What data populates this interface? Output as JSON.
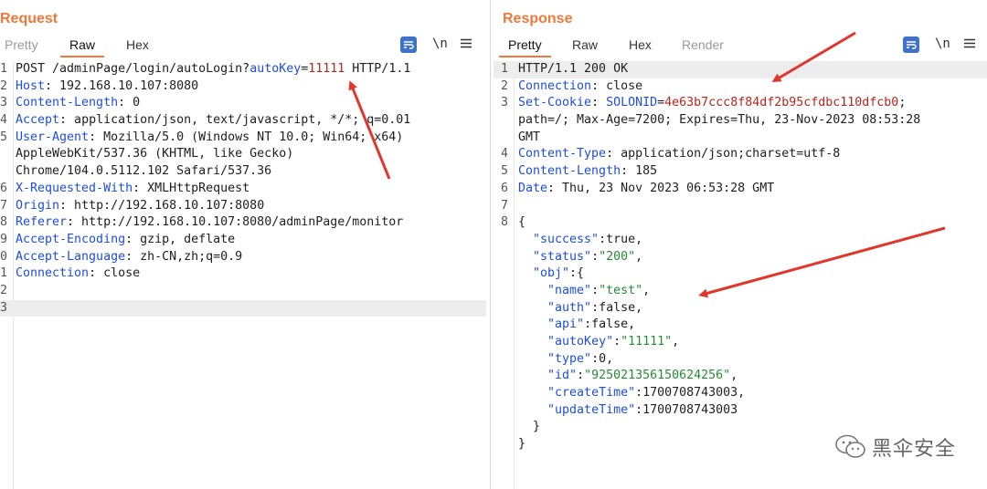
{
  "request": {
    "title": "Request",
    "tabs": [
      "Pretty",
      "Raw",
      "Hex"
    ],
    "active_tab": "Raw",
    "tools": {
      "newline_label": "\\n",
      "menu_icon": "hamburger-menu-icon",
      "wrap_icon": "text-wrap-icon"
    },
    "lines": [
      {
        "n": "1",
        "parts": [
          [
            "t",
            "POST /adminPage/login/autoLogin?"
          ],
          [
            "k",
            "autoKey"
          ],
          [
            "t",
            "="
          ],
          [
            "n",
            "11111"
          ],
          [
            "t",
            " HTTP/1.1"
          ]
        ]
      },
      {
        "n": "2",
        "parts": [
          [
            "k",
            "Host"
          ],
          [
            "t",
            ": 192.168.10.107:8080"
          ]
        ]
      },
      {
        "n": "3",
        "parts": [
          [
            "k",
            "Content-Length"
          ],
          [
            "t",
            ": 0"
          ]
        ]
      },
      {
        "n": "4",
        "parts": [
          [
            "k",
            "Accept"
          ],
          [
            "t",
            ": application/json, text/javascript, */*; q=0.01"
          ]
        ]
      },
      {
        "n": "5",
        "parts": [
          [
            "k",
            "User-Agent"
          ],
          [
            "t",
            ": Mozilla/5.0 (Windows NT 10.0; Win64; x64)"
          ]
        ]
      },
      {
        "n": "",
        "parts": [
          [
            "t",
            "AppleWebKit/537.36 (KHTML, like Gecko)"
          ]
        ]
      },
      {
        "n": "",
        "parts": [
          [
            "t",
            "Chrome/104.0.5112.102 Safari/537.36"
          ]
        ]
      },
      {
        "n": "6",
        "parts": [
          [
            "k",
            "X-Requested-With"
          ],
          [
            "t",
            ": XMLHttpRequest"
          ]
        ]
      },
      {
        "n": "7",
        "parts": [
          [
            "k",
            "Origin"
          ],
          [
            "t",
            ": http://192.168.10.107:8080"
          ]
        ]
      },
      {
        "n": "8",
        "parts": [
          [
            "k",
            "Referer"
          ],
          [
            "t",
            ": http://192.168.10.107:8080/adminPage/monitor"
          ]
        ]
      },
      {
        "n": "9",
        "parts": [
          [
            "k",
            "Accept-Encoding"
          ],
          [
            "t",
            ": gzip, deflate"
          ]
        ]
      },
      {
        "n": "0",
        "parts": [
          [
            "k",
            "Accept-Language"
          ],
          [
            "t",
            ": zh-CN,zh;q=0.9"
          ]
        ]
      },
      {
        "n": "1",
        "parts": [
          [
            "k",
            "Connection"
          ],
          [
            "t",
            ": close"
          ]
        ]
      },
      {
        "n": "2",
        "parts": []
      },
      {
        "n": "3",
        "parts": [],
        "highlight": true
      }
    ]
  },
  "response": {
    "title": "Response",
    "tabs": [
      "Pretty",
      "Raw",
      "Hex",
      "Render"
    ],
    "active_tab": "Pretty",
    "muted_tabs": [
      "Render"
    ],
    "tools": {
      "newline_label": "\\n",
      "menu_icon": "hamburger-menu-icon",
      "wrap_icon": "text-wrap-icon"
    },
    "lines": [
      {
        "n": "1",
        "parts": [
          [
            "t",
            "HTTP/1.1 200 OK"
          ]
        ],
        "highlight": true
      },
      {
        "n": "2",
        "parts": [
          [
            "k",
            "Connection"
          ],
          [
            "t",
            ": close"
          ]
        ]
      },
      {
        "n": "3",
        "parts": [
          [
            "k",
            "Set-Cookie"
          ],
          [
            "t",
            ": "
          ],
          [
            "k",
            "SOLONID"
          ],
          [
            "t",
            "="
          ],
          [
            "n",
            "4e63b7ccc8f84df2b95cfdbc110dfcb0"
          ],
          [
            "t",
            ";"
          ]
        ]
      },
      {
        "n": "",
        "parts": [
          [
            "t",
            "path=/; Max-Age=7200; Expires=Thu, 23-Nov-2023 08:53:28"
          ]
        ]
      },
      {
        "n": "",
        "parts": [
          [
            "t",
            "GMT"
          ]
        ]
      },
      {
        "n": "4",
        "parts": [
          [
            "k",
            "Content-Type"
          ],
          [
            "t",
            ": application/json;charset=utf-8"
          ]
        ]
      },
      {
        "n": "5",
        "parts": [
          [
            "k",
            "Content-Length"
          ],
          [
            "t",
            ": 185"
          ]
        ]
      },
      {
        "n": "6",
        "parts": [
          [
            "k",
            "Date"
          ],
          [
            "t",
            ": Thu, 23 Nov 2023 06:53:28 GMT"
          ]
        ]
      },
      {
        "n": "7",
        "parts": []
      },
      {
        "n": "8",
        "parts": [
          [
            "t",
            "{"
          ]
        ]
      },
      {
        "n": "",
        "parts": [
          [
            "t",
            "  "
          ],
          [
            "k",
            "\"success\""
          ],
          [
            "t",
            ":true,"
          ]
        ]
      },
      {
        "n": "",
        "parts": [
          [
            "t",
            "  "
          ],
          [
            "k",
            "\"status\""
          ],
          [
            "t",
            ":"
          ],
          [
            "s",
            "\"200\""
          ],
          [
            "t",
            ","
          ]
        ]
      },
      {
        "n": "",
        "parts": [
          [
            "t",
            "  "
          ],
          [
            "k",
            "\"obj\""
          ],
          [
            "t",
            ":{"
          ]
        ]
      },
      {
        "n": "",
        "parts": [
          [
            "t",
            "    "
          ],
          [
            "k",
            "\"name\""
          ],
          [
            "t",
            ":"
          ],
          [
            "s",
            "\"test\""
          ],
          [
            "t",
            ","
          ]
        ]
      },
      {
        "n": "",
        "parts": [
          [
            "t",
            "    "
          ],
          [
            "k",
            "\"auth\""
          ],
          [
            "t",
            ":false,"
          ]
        ]
      },
      {
        "n": "",
        "parts": [
          [
            "t",
            "    "
          ],
          [
            "k",
            "\"api\""
          ],
          [
            "t",
            ":false,"
          ]
        ]
      },
      {
        "n": "",
        "parts": [
          [
            "t",
            "    "
          ],
          [
            "k",
            "\"autoKey\""
          ],
          [
            "t",
            ":"
          ],
          [
            "s",
            "\"11111\""
          ],
          [
            "t",
            ","
          ]
        ]
      },
      {
        "n": "",
        "parts": [
          [
            "t",
            "    "
          ],
          [
            "k",
            "\"type\""
          ],
          [
            "t",
            ":0,"
          ]
        ]
      },
      {
        "n": "",
        "parts": [
          [
            "t",
            "    "
          ],
          [
            "k",
            "\"id\""
          ],
          [
            "t",
            ":"
          ],
          [
            "s",
            "\"925021356150624256\""
          ],
          [
            "t",
            ","
          ]
        ]
      },
      {
        "n": "",
        "parts": [
          [
            "t",
            "    "
          ],
          [
            "k",
            "\"createTime\""
          ],
          [
            "t",
            ":1700708743003,"
          ]
        ]
      },
      {
        "n": "",
        "parts": [
          [
            "t",
            "    "
          ],
          [
            "k",
            "\"updateTime\""
          ],
          [
            "t",
            ":1700708743003"
          ]
        ]
      },
      {
        "n": "",
        "parts": [
          [
            "t",
            "  }"
          ]
        ]
      },
      {
        "n": "",
        "parts": [
          [
            "t",
            "}"
          ]
        ]
      }
    ]
  },
  "watermark": {
    "text": "黑伞安全",
    "icon": "wechat-icon"
  },
  "colors": {
    "accent": "#f0793a",
    "key": "#1f4ed8",
    "number": "#b5261e",
    "string": "#258a36",
    "arrow": "#e0362b",
    "toolbar_blue": "#3f73c9"
  }
}
